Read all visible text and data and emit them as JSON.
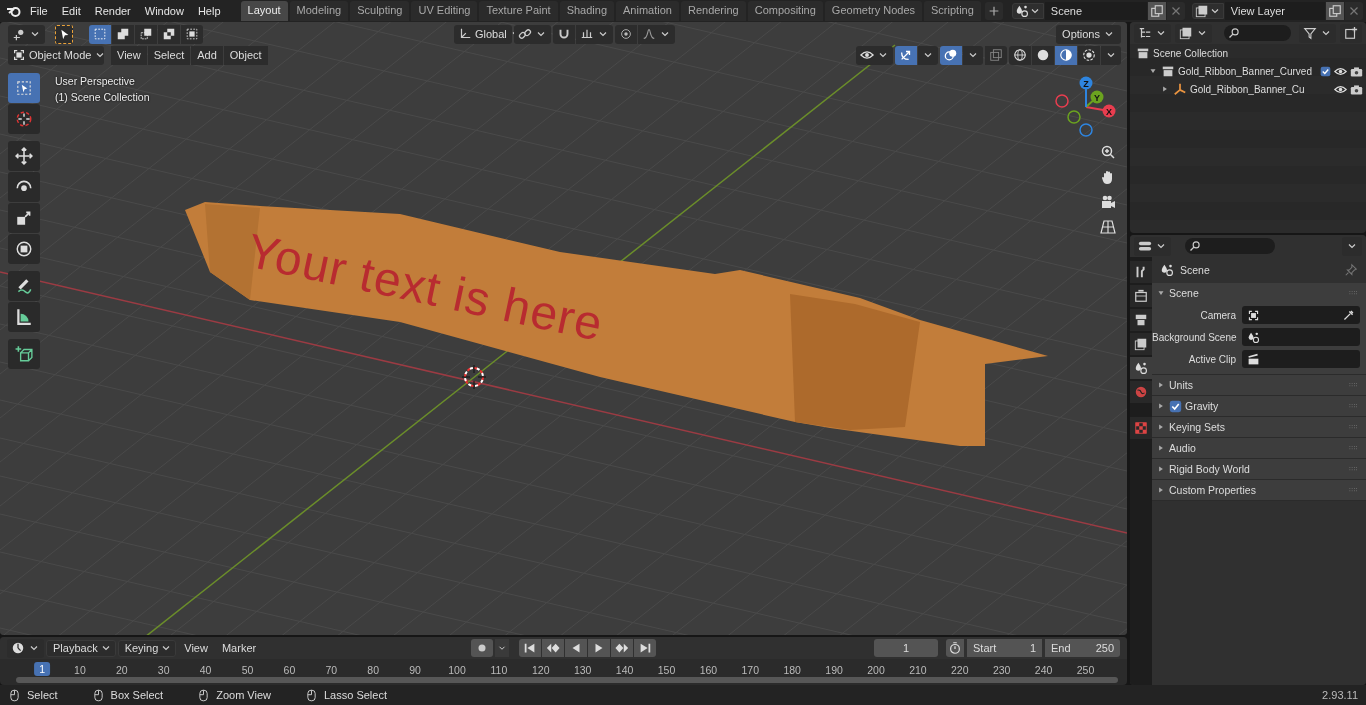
{
  "menu": [
    "File",
    "Edit",
    "Render",
    "Window",
    "Help"
  ],
  "workspaces": [
    {
      "label": "Layout",
      "selected": true
    },
    {
      "label": "Modeling",
      "selected": false
    },
    {
      "label": "Sculpting",
      "selected": false
    },
    {
      "label": "UV Editing",
      "selected": false
    },
    {
      "label": "Texture Paint",
      "selected": false
    },
    {
      "label": "Shading",
      "selected": false
    },
    {
      "label": "Animation",
      "selected": false
    },
    {
      "label": "Rendering",
      "selected": false
    },
    {
      "label": "Compositing",
      "selected": false
    },
    {
      "label": "Geometry Nodes",
      "selected": false
    },
    {
      "label": "Scripting",
      "selected": false
    }
  ],
  "scene": {
    "value": "Scene"
  },
  "view_layer": {
    "value": "View Layer"
  },
  "viewport": {
    "select_modes": [
      {
        "kind": "set",
        "selected": true
      },
      {
        "kind": "extend",
        "selected": false
      },
      {
        "kind": "subtract",
        "selected": false
      },
      {
        "kind": "difference",
        "selected": false
      },
      {
        "kind": "intersect",
        "selected": false
      }
    ],
    "orientation": "Global",
    "options": "Options",
    "mode": "Object Mode",
    "menus": [
      "View",
      "Select",
      "Add",
      "Object"
    ],
    "toggles": [
      {
        "kind": "gizmo",
        "on": true
      },
      {
        "kind": "overlays",
        "on": true
      },
      {
        "kind": "xray",
        "on": false
      }
    ],
    "shading": [
      {
        "kind": "wire",
        "selected": false
      },
      {
        "kind": "solid",
        "selected": false
      },
      {
        "kind": "material",
        "selected": true
      },
      {
        "kind": "render",
        "selected": false
      }
    ],
    "info": [
      "User Perspective",
      "(1) Scene Collection"
    ],
    "object_text": "Your text is here",
    "tools": [
      {
        "kind": "select_box",
        "selected": true
      },
      {
        "kind": "cursor",
        "selected": false
      },
      {
        "kind": "move",
        "selected": false
      },
      {
        "kind": "rotate",
        "selected": false
      },
      {
        "kind": "scale",
        "selected": false
      },
      {
        "kind": "transform",
        "selected": false
      },
      {
        "kind": "annotate",
        "selected": false
      },
      {
        "kind": "measure",
        "selected": false
      },
      {
        "kind": "add_cube",
        "selected": false
      }
    ],
    "gizmo_axes": [
      {
        "label": "X",
        "color": "#e83d4f"
      },
      {
        "label": "Y",
        "color": "#6ba31f"
      },
      {
        "label": "Z",
        "color": "#2e85e0"
      }
    ]
  },
  "outliner": {
    "items": [
      {
        "label": "Scene Collection",
        "kind": "scene_collection",
        "children": [
          {
            "label": "Gold_Ribbon_Banner_Curved",
            "kind": "collection",
            "expanded": true,
            "checked": true,
            "children": [
              {
                "label": "Gold_Ribbon_Banner_Cu",
                "kind": "empty",
                "expanded": false
              }
            ]
          }
        ]
      }
    ]
  },
  "properties": {
    "tabs": [
      {
        "kind": "tool",
        "selected": false
      },
      {
        "kind": "render",
        "selected": false
      },
      {
        "kind": "output",
        "selected": false
      },
      {
        "kind": "view_layer",
        "selected": false
      },
      {
        "kind": "scene",
        "selected": true
      },
      {
        "kind": "world",
        "selected": false
      },
      {
        "kind": "texture",
        "selected": false
      }
    ],
    "title": "Scene",
    "panels": [
      {
        "label": "Scene",
        "expanded": true,
        "fields": [
          {
            "label": "Camera",
            "kind": "camera"
          },
          {
            "label": "Background Scene",
            "kind": "scene"
          },
          {
            "label": "Active Clip",
            "kind": "clip"
          }
        ]
      },
      {
        "label": "Units",
        "expanded": false
      },
      {
        "label": "Gravity",
        "expanded": false,
        "checked": true
      },
      {
        "label": "Keying Sets",
        "expanded": false
      },
      {
        "label": "Audio",
        "expanded": false
      },
      {
        "label": "Rigid Body World",
        "expanded": false
      },
      {
        "label": "Custom Properties",
        "expanded": false
      }
    ]
  },
  "timeline": {
    "menus": [
      {
        "label": "Playback",
        "kind": "dropdown"
      },
      {
        "label": "Keying",
        "kind": "dropdown"
      },
      {
        "label": "View",
        "kind": "menu"
      },
      {
        "label": "Marker",
        "kind": "menu"
      }
    ],
    "current_frame": "1",
    "start": {
      "label": "Start",
      "value": "1"
    },
    "end": {
      "label": "End",
      "value": "250"
    },
    "ruler": [
      "1",
      "10",
      "20",
      "30",
      "40",
      "50",
      "60",
      "70",
      "80",
      "90",
      "100",
      "110",
      "120",
      "130",
      "140",
      "150",
      "160",
      "170",
      "180",
      "190",
      "200",
      "210",
      "220",
      "230",
      "240",
      "250"
    ]
  },
  "status_bar": {
    "hints": [
      "Select",
      "Box Select",
      "Zoom View",
      "Lasso Select"
    ],
    "version": "2.93.11"
  }
}
